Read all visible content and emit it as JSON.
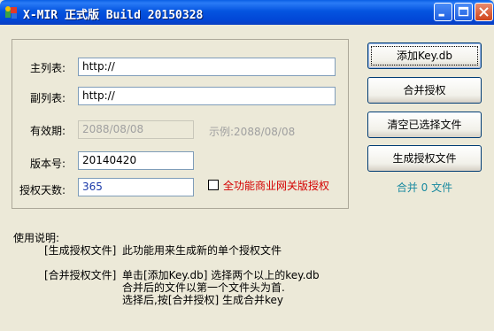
{
  "window": {
    "title": "X-MIR 正式版 Build 20150328",
    "controls": {
      "minimize": "minimize",
      "maximize": "maximize",
      "close": "close"
    }
  },
  "form": {
    "main_list": {
      "label": "主列表:",
      "value": "http://"
    },
    "sub_list": {
      "label": "副列表:",
      "value": "http://"
    },
    "expiry": {
      "label": "有效期:",
      "value": "2088/08/08",
      "example": "示例:2088/08/08"
    },
    "version": {
      "label": "版本号:",
      "value": "20140420"
    },
    "auth_days": {
      "label": "授权天数:",
      "value": "365"
    },
    "full_feature": {
      "label": "全功能商业网关版授权",
      "checked": false
    }
  },
  "buttons": {
    "add_key": "添加Key.db",
    "merge_auth": "合并授权",
    "clear_selected": "清空已选择文件",
    "generate_auth": "生成授权文件"
  },
  "merge_status": "合并 0 文件",
  "usage": {
    "heading": "使用说明:",
    "gen_tag": "[生成授权文件]",
    "gen_desc": "此功能用来生成新的单个授权文件",
    "merge_tag": "[合并授权文件]",
    "merge_line1": "单击[添加Key.db] 选择两个以上的key.db",
    "merge_line2": "合并后的文件以第一个文件头为首.",
    "merge_line3": "选择后,按[合并授权] 生成合并key"
  },
  "colors": {
    "titlebar": "#0454e0",
    "dialog_bg": "#ece9d8",
    "red_label": "#d40000",
    "merge_status": "#1a8aa0"
  }
}
